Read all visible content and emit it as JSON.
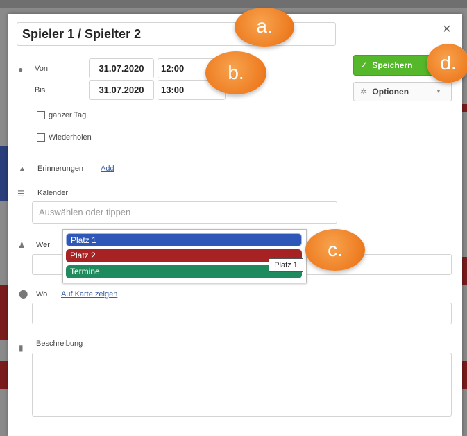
{
  "dialog": {
    "title_value": "Spieler 1 / Spielter 2",
    "close_glyph": "×"
  },
  "time": {
    "from_label": "Von",
    "from_date": "31.07.2020",
    "from_time": "12:00",
    "to_label": "Bis",
    "to_date": "31.07.2020",
    "to_time": "13:00",
    "all_day_label": "ganzer Tag",
    "repeat_label": "Wiederholen"
  },
  "actions": {
    "save_label": "Speichern",
    "options_label": "Optionen"
  },
  "reminders": {
    "label": "Erinnerungen",
    "add_link": "Add"
  },
  "calendar": {
    "label": "Kalender",
    "placeholder": "Auswählen oder tippen",
    "options": [
      {
        "label": "Platz 1",
        "color": "#2f57b8"
      },
      {
        "label": "Platz 2",
        "color": "#a62223"
      },
      {
        "label": "Termine",
        "color": "#1e8a5e"
      }
    ],
    "tooltip": "Platz 1"
  },
  "who": {
    "label": "Wer"
  },
  "where": {
    "label": "Wo",
    "map_link": "Auf Karte zeigen"
  },
  "description": {
    "label": "Beschreibung"
  },
  "annotations": [
    "a.",
    "b.",
    "c.",
    "d."
  ],
  "colors": {
    "save_green": "#55b72a",
    "annotation_orange": "#ee7d22"
  }
}
